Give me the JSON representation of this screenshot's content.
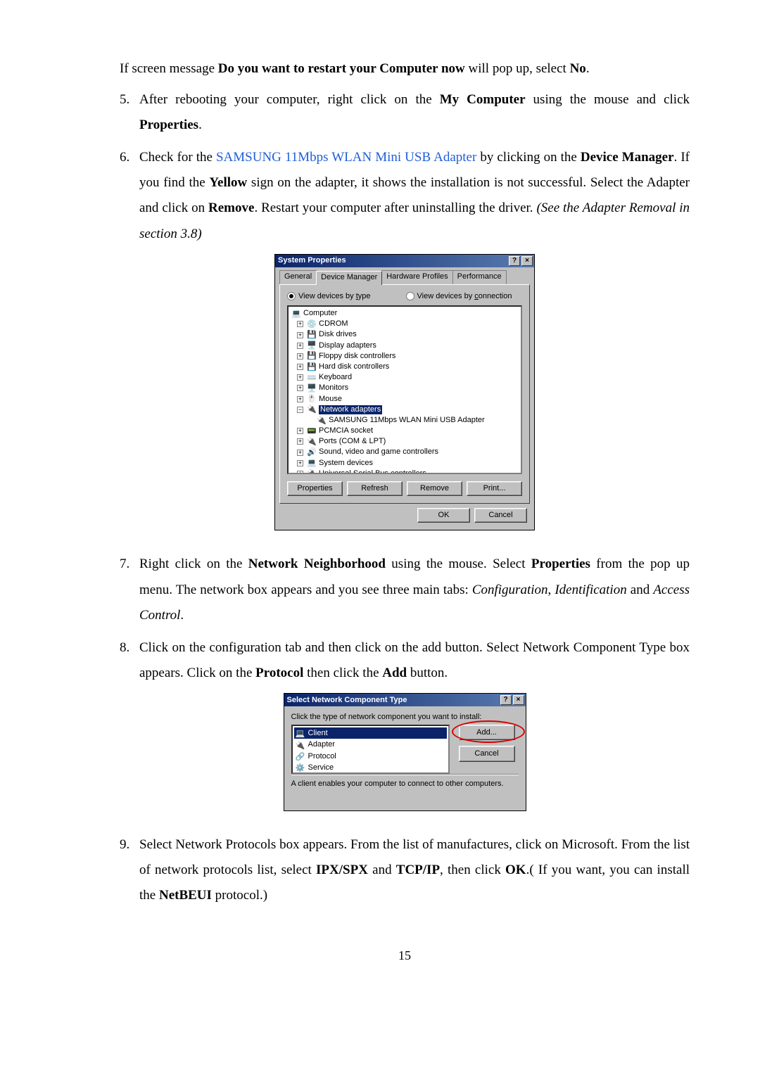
{
  "para1": {
    "pre": "If screen message ",
    "bold": "Do you want to restart your Computer now",
    "mid": " will pop up, select ",
    "no": "No",
    "post": "."
  },
  "item5": {
    "num": "5.",
    "a": "After rebooting your computer, right click on the ",
    "b": "My Computer",
    "c": " using the mouse and click ",
    "d": "Properties",
    "e": "."
  },
  "item6": {
    "num": "6.",
    "a": "Check for the ",
    "link": "SAMSUNG 11Mbps WLAN Mini USB Adapter",
    "b": " by clicking on the ",
    "c": "Device Manager",
    "d": ". If you find the ",
    "e": "Yellow",
    "f": " sign on the adapter, it shows the installation is not successful. Select the Adapter and click on ",
    "g": "Remove",
    "h": ". Restart your computer after uninstalling the driver. ",
    "i": "(See the Adapter Removal in section 3.8)"
  },
  "sysprops": {
    "title": "System Properties",
    "tabs": [
      "General",
      "Device Manager",
      "Hardware Profiles",
      "Performance"
    ],
    "radio1": {
      "label": "View devices by type",
      "u": "t"
    },
    "radio2": {
      "label": "View devices by connection",
      "u": "c"
    },
    "tree": [
      {
        "l": "Computer",
        "top": true
      },
      {
        "l": "CDROM",
        "exp": "+"
      },
      {
        "l": "Disk drives",
        "exp": "+"
      },
      {
        "l": "Display adapters",
        "exp": "+"
      },
      {
        "l": "Floppy disk controllers",
        "exp": "+"
      },
      {
        "l": "Hard disk controllers",
        "exp": "+"
      },
      {
        "l": "Keyboard",
        "exp": "+"
      },
      {
        "l": "Monitors",
        "exp": "+"
      },
      {
        "l": "Mouse",
        "exp": "+"
      },
      {
        "l": "Network adapters",
        "exp": "−",
        "sel": true
      },
      {
        "l": "SAMSUNG 11Mbps WLAN Mini USB Adapter",
        "child": true
      },
      {
        "l": "PCMCIA socket",
        "exp": "+"
      },
      {
        "l": "Ports (COM & LPT)",
        "exp": "+"
      },
      {
        "l": "Sound, video and game controllers",
        "exp": "+"
      },
      {
        "l": "System devices",
        "exp": "+"
      },
      {
        "l": "Universal Serial Bus controllers",
        "exp": "+"
      }
    ],
    "btns": [
      "Properties",
      "Refresh",
      "Remove",
      "Print..."
    ],
    "okcancel": [
      "OK",
      "Cancel"
    ]
  },
  "item7": {
    "num": "7.",
    "a": "Right click on the ",
    "b": "Network Neighborhood",
    "c": " using the mouse. Select ",
    "d": "Properties",
    "e": " from the pop up menu. The network box appears and you see three main tabs: ",
    "f": "Configuration",
    "g": ", ",
    "h": "Identification",
    "i": " and ",
    "j": "Access Control",
    "k": "."
  },
  "item8": {
    "num": "8.",
    "a": "Click on the configuration tab and then click on the add button. Select Network Component Type box appears. Click on the ",
    "b": "Protocol",
    "c": " then click the ",
    "d": "Add",
    "e": " button."
  },
  "selnet": {
    "title": "Select Network Component Type",
    "prompt": "Click the type of network component you want to install:",
    "items": [
      "Client",
      "Adapter",
      "Protocol",
      "Service"
    ],
    "add": "Add...",
    "cancel": "Cancel",
    "desc": "A client enables your computer to connect to other computers."
  },
  "item9": {
    "num": "9.",
    "a": "Select Network Protocols box appears. From the list of manufactures, click on Microsoft. From the list of network protocols list, select ",
    "b": "IPX/SPX",
    "c": " and ",
    "d": "TCP/IP",
    "e": ", then click ",
    "f": "OK",
    "g": ".( If you want, you can install the ",
    "h": "NetBEUI",
    "i": " protocol.)"
  },
  "page": "15"
}
